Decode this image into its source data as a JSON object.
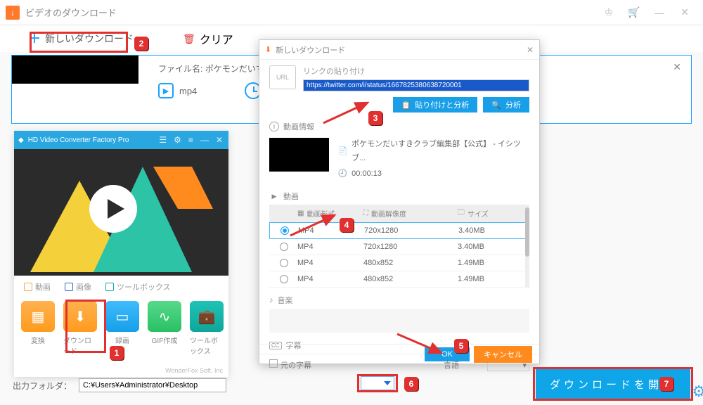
{
  "titlebar": {
    "title": "ビデオのダウンロード"
  },
  "toolbar": {
    "new_download": "新しいダウンロード",
    "clear": "クリア"
  },
  "item": {
    "filename_label": "ファイル名:",
    "filename": "ポケモンだいすきクラブ編集部",
    "format": "mp4"
  },
  "promo": {
    "title": "HD Video Converter Factory Pro",
    "tabs": [
      "動画",
      "画像",
      "ツールボックス"
    ],
    "tiles": [
      {
        "label": "変換"
      },
      {
        "label": "ダウンロード"
      },
      {
        "label": "録画"
      },
      {
        "label": "GIF作成"
      },
      {
        "label": "ツールボックス"
      }
    ],
    "footer": "WonderFox Soft, Inc"
  },
  "modal": {
    "title": "新しいダウンロード",
    "paste_label": "リンクの貼り付け",
    "url_value": "https://twitter.com/i/status/1667825380638720001",
    "paste_analyze": "貼り付けと分析",
    "analyze": "分析",
    "info_head": "動画情報",
    "video_title": "ポケモンだいすきクラブ編集部【公式】 - イシツブ...",
    "duration": "00:00:13",
    "section_video": "動画",
    "col_format": "動画形式",
    "col_res": "動画解像度",
    "col_size": "サイズ",
    "rows": [
      {
        "fmt": "MP4",
        "res": "720x1280",
        "size": "3.40MB",
        "selected": true
      },
      {
        "fmt": "MP4",
        "res": "720x1280",
        "size": "3.40MB",
        "selected": false
      },
      {
        "fmt": "MP4",
        "res": "480x852",
        "size": "1.49MB",
        "selected": false
      },
      {
        "fmt": "MP4",
        "res": "480x852",
        "size": "1.49MB",
        "selected": false
      }
    ],
    "section_audio": "音楽",
    "section_sub": "字幕",
    "orig_sub": "元の字幕",
    "lang_label": "言語",
    "ok": "OK",
    "cancel": "キャンセル"
  },
  "bottom": {
    "out_label": "出力フォルダ：",
    "path": "C:¥Users¥Administrator¥Desktop",
    "download_start": "ダウンロードを開始"
  },
  "badges": {
    "1": "1",
    "2": "2",
    "3": "3",
    "4": "4",
    "5": "5",
    "6": "6",
    "7": "7"
  }
}
